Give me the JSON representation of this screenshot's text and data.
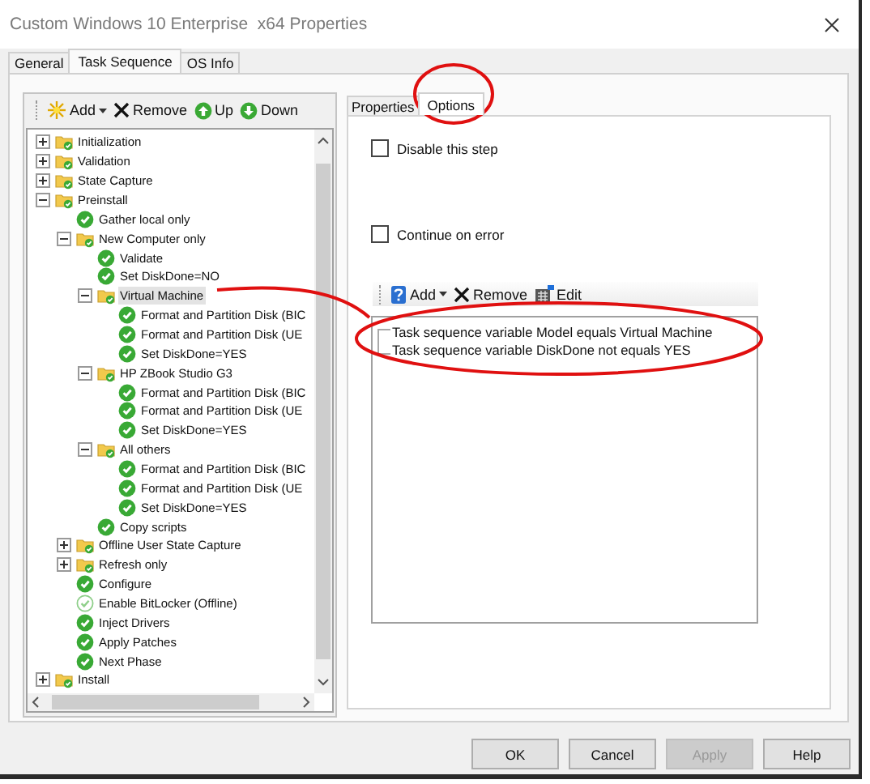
{
  "window": {
    "title": "Custom Windows 10 Enterprise  x64 Properties"
  },
  "tabs": [
    {
      "label": "General",
      "selected": false
    },
    {
      "label": "Task Sequence",
      "selected": true
    },
    {
      "label": "OS Info",
      "selected": false
    }
  ],
  "tree_toolbar": [
    {
      "kind": "add",
      "label": "Add"
    },
    {
      "kind": "remove",
      "label": "Remove"
    },
    {
      "kind": "up",
      "label": "Up"
    },
    {
      "kind": "down",
      "label": "Down"
    }
  ],
  "tree": [
    {
      "label": "Initialization",
      "kind": "group",
      "expanded": false,
      "selected": false
    },
    {
      "label": "Validation",
      "kind": "group",
      "expanded": false,
      "selected": false
    },
    {
      "label": "State Capture",
      "kind": "group",
      "expanded": false,
      "selected": false
    },
    {
      "label": "Preinstall",
      "kind": "group",
      "expanded": true,
      "selected": false,
      "children": [
        {
          "label": "Gather local only",
          "kind": "step",
          "disabled": false,
          "selected": false
        },
        {
          "label": "New Computer only",
          "kind": "group",
          "expanded": true,
          "selected": false,
          "children": [
            {
              "label": "Validate",
              "kind": "step",
              "disabled": false,
              "selected": false
            },
            {
              "label": "Set DiskDone=NO",
              "kind": "step",
              "disabled": false,
              "selected": false
            },
            {
              "label": "Virtual Machine",
              "kind": "group",
              "expanded": true,
              "selected": true,
              "children": [
                {
                  "label": "Format and Partition Disk (BIC",
                  "kind": "step",
                  "disabled": false,
                  "selected": false
                },
                {
                  "label": "Format and Partition Disk (UE",
                  "kind": "step",
                  "disabled": false,
                  "selected": false
                },
                {
                  "label": "Set DiskDone=YES",
                  "kind": "step",
                  "disabled": false,
                  "selected": false
                }
              ]
            },
            {
              "label": "HP ZBook Studio G3",
              "kind": "group",
              "expanded": true,
              "selected": false,
              "children": [
                {
                  "label": "Format and Partition Disk (BIC",
                  "kind": "step",
                  "disabled": false,
                  "selected": false
                },
                {
                  "label": "Format and Partition Disk (UE",
                  "kind": "step",
                  "disabled": false,
                  "selected": false
                },
                {
                  "label": "Set DiskDone=YES",
                  "kind": "step",
                  "disabled": false,
                  "selected": false
                }
              ]
            },
            {
              "label": "All others",
              "kind": "group",
              "expanded": true,
              "selected": false,
              "children": [
                {
                  "label": "Format and Partition Disk (BIC",
                  "kind": "step",
                  "disabled": false,
                  "selected": false
                },
                {
                  "label": "Format and Partition Disk (UE",
                  "kind": "step",
                  "disabled": false,
                  "selected": false
                },
                {
                  "label": "Set DiskDone=YES",
                  "kind": "step",
                  "disabled": false,
                  "selected": false
                }
              ]
            },
            {
              "label": "Copy scripts",
              "kind": "step",
              "disabled": false,
              "selected": false
            }
          ]
        },
        {
          "label": "Offline User State Capture",
          "kind": "group",
          "expanded": false,
          "selected": false
        },
        {
          "label": "Refresh only",
          "kind": "group",
          "expanded": false,
          "selected": false
        },
        {
          "label": "Configure",
          "kind": "step",
          "disabled": false,
          "selected": false
        },
        {
          "label": "Enable BitLocker (Offline)",
          "kind": "step",
          "disabled": true,
          "selected": false
        },
        {
          "label": "Inject Drivers",
          "kind": "step",
          "disabled": false,
          "selected": false
        },
        {
          "label": "Apply Patches",
          "kind": "step",
          "disabled": false,
          "selected": false
        },
        {
          "label": "Next Phase",
          "kind": "step",
          "disabled": false,
          "selected": false
        }
      ]
    },
    {
      "label": "Install",
      "kind": "group",
      "expanded": false,
      "selected": false
    }
  ],
  "step_tabs": [
    {
      "label": "Properties",
      "selected": false
    },
    {
      "label": "Options",
      "selected": true
    }
  ],
  "options": [
    {
      "label": "Disable this step",
      "checked": false
    },
    {
      "label": "Continue on error",
      "checked": false
    }
  ],
  "condition_toolbar": [
    {
      "kind": "add",
      "label": "Add"
    },
    {
      "kind": "remove",
      "label": "Remove"
    },
    {
      "kind": "edit",
      "label": "Edit"
    }
  ],
  "conditions": [
    "Task sequence variable Model equals Virtual Machine",
    "Task sequence variable DiskDone not equals YES"
  ],
  "buttons": [
    {
      "label": "OK",
      "disabled": false
    },
    {
      "label": "Cancel",
      "disabled": false
    },
    {
      "label": "Apply",
      "disabled": true
    },
    {
      "label": "Help",
      "disabled": false
    }
  ]
}
